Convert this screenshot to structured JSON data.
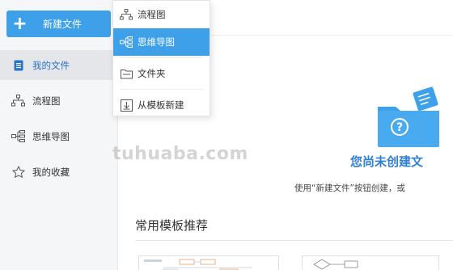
{
  "sidebar": {
    "new_button": {
      "icon": "plus-icon",
      "label": "新建文件"
    },
    "items": [
      {
        "icon": "document-icon",
        "label": "我的文件",
        "active": true
      },
      {
        "icon": "flowchart-icon",
        "label": "流程图"
      },
      {
        "icon": "mindmap-icon",
        "label": "思维导图"
      },
      {
        "icon": "star-icon",
        "label": "我的收藏"
      }
    ]
  },
  "dropdown": {
    "items": [
      {
        "icon": "flowchart-icon",
        "label": "流程图"
      },
      {
        "icon": "mindmap-icon",
        "label": "思维导图",
        "active": true
      },
      {
        "icon": "folder-icon",
        "label": "文件夹"
      },
      {
        "icon": "template-icon",
        "label": "从模板新建"
      }
    ]
  },
  "main": {
    "empty_illustration_icon": "folder-question-icon",
    "empty_title": "您尚未创建文",
    "empty_hint": "使用“新建文件”按钮创建，或",
    "templates_title": "常用模板推荐"
  },
  "watermark": "tuhuaba.com",
  "colors": {
    "accent": "#3da0e8",
    "title_blue": "#2f7fd3"
  }
}
